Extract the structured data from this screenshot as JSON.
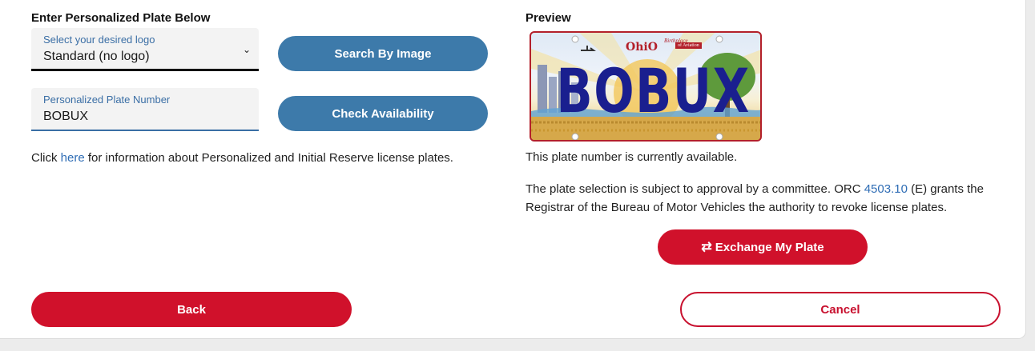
{
  "left": {
    "heading": "Enter Personalized Plate Below",
    "logo_select": {
      "label": "Select your desired logo",
      "value": "Standard (no logo)"
    },
    "plate_input": {
      "label": "Personalized Plate Number",
      "value": "BOBUX"
    },
    "search_button": "Search By Image",
    "check_button": "Check Availability",
    "info": {
      "before": "Click ",
      "link": "here",
      "after": " for information about Personalized and Initial Reserve license plates."
    }
  },
  "right": {
    "heading": "Preview",
    "plate": {
      "number": "BOBUX",
      "state": "OhiO",
      "tagline_top": "Birthplace",
      "tagline_aviation": "of Aviation"
    },
    "status": "This plate number is currently available.",
    "note": {
      "before": "The plate selection is subject to approval by a committee. ORC ",
      "link": "4503.10",
      "after": " (E) grants the Registrar of the Bureau of Motor Vehicles the authority to revoke license plates."
    },
    "exchange_button": "Exchange My Plate",
    "exchange_icon": "exchange-arrows-icon"
  },
  "footer": {
    "back_button": "Back",
    "cancel_button": "Cancel"
  },
  "colors": {
    "blue_button": "#3d7aaa",
    "red_button": "#d0112b",
    "link": "#2f6db5",
    "plate_text": "#1a1f8f"
  }
}
